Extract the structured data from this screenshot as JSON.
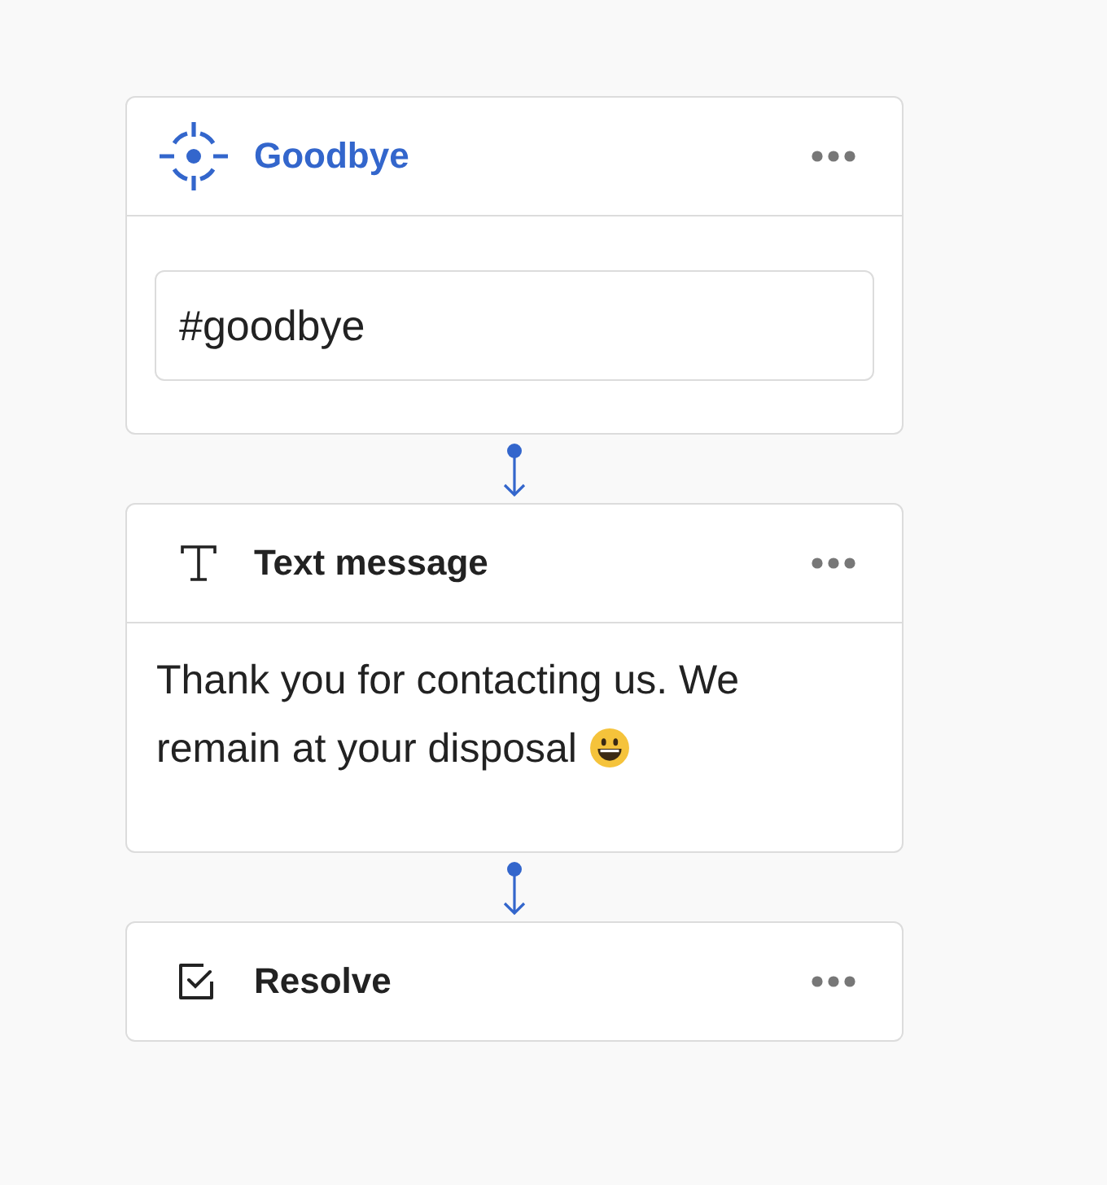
{
  "blocks": [
    {
      "kind": "trigger",
      "title": "Goodbye",
      "input": {
        "value": "#goodbye"
      }
    },
    {
      "kind": "text",
      "title": "Text message",
      "message": "Thank you for contacting us. We remain at your disposal",
      "emoji": true
    },
    {
      "kind": "resolve",
      "title": "Resolve"
    }
  ]
}
